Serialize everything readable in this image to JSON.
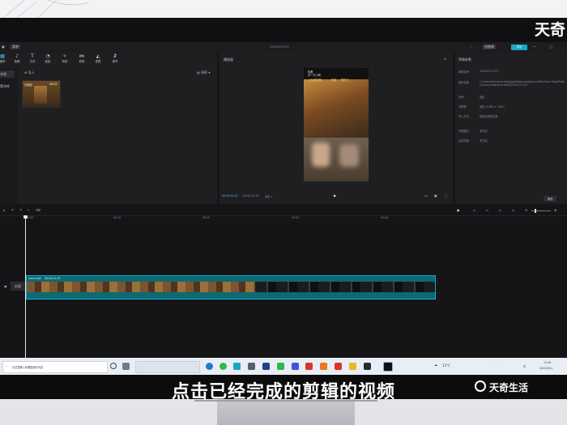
{
  "watermark": {
    "top": "天奇",
    "bottom": "天奇生活"
  },
  "subtitle": "点击已经完成的剪辑的视频",
  "app": {
    "menu_label": "菜单",
    "window_title": "202203211137",
    "shortcut_label": "快捷键",
    "export_label": "导出",
    "toolbar": [
      {
        "label": "媒体",
        "icon": "media-icon"
      },
      {
        "label": "音频",
        "icon": "audio-icon"
      },
      {
        "label": "文本",
        "icon": "text-icon"
      },
      {
        "label": "贴纸",
        "icon": "sticker-icon"
      },
      {
        "label": "特效",
        "icon": "effects-icon"
      },
      {
        "label": "转场",
        "icon": "transition-icon"
      },
      {
        "label": "滤镜",
        "icon": "filter-icon"
      },
      {
        "label": "调节",
        "icon": "adjust-icon"
      }
    ],
    "sidebar": {
      "items": [
        "本地",
        "素材库"
      ]
    },
    "media": {
      "import_label": "导入",
      "sort_label": "排序",
      "clip_tag": "已添加",
      "clip_duration": "00:23"
    },
    "player": {
      "title": "播放器",
      "current_time": "00:00:00:00",
      "total_time": "00:00:22:29",
      "ratio_label": "适应",
      "video_overlay_line1": "抖音",
      "video_overlay_line2": "@一只小鸭",
      "video_overlay_line3": "《大明王朝》",
      "video_overlay_line4": "哈哈",
      "video_overlay_line5": "笑死了"
    },
    "draft": {
      "title": "草稿参数",
      "fields": [
        {
          "label": "草稿名称:",
          "value": "202203211137"
        },
        {
          "label": "保存位置:",
          "value": "C:/Users/Administrator/AppData/Local/JianyingPro/User Data/Projects/com.lveditor.draft/202203211137"
        },
        {
          "label": "比例:",
          "value": "适应"
        },
        {
          "label": "分辨率:",
          "value": "适应 (1080 × 1920)"
        },
        {
          "label": "导入方式:",
          "value": "保留在原有位置"
        },
        {
          "label": "代理模式:",
          "value": "未开启"
        },
        {
          "label": "自由层级:",
          "value": "未开启"
        }
      ],
      "modify_label": "修改"
    },
    "timeline": {
      "ticks": [
        "00:00",
        "00:10",
        "00:20",
        "00:30",
        "00:40"
      ],
      "clip_name": "xxxx.mp4",
      "clip_duration": "00:00:22:29",
      "track_label": "封面"
    }
  },
  "taskbar": {
    "search_placeholder": "在这里输入你要搜索的内容",
    "temperature": "13°C",
    "time": "11:49",
    "date": "2022/3/21"
  },
  "colors": {
    "accent": "#1aa7c4",
    "track": "#0b6a73"
  }
}
